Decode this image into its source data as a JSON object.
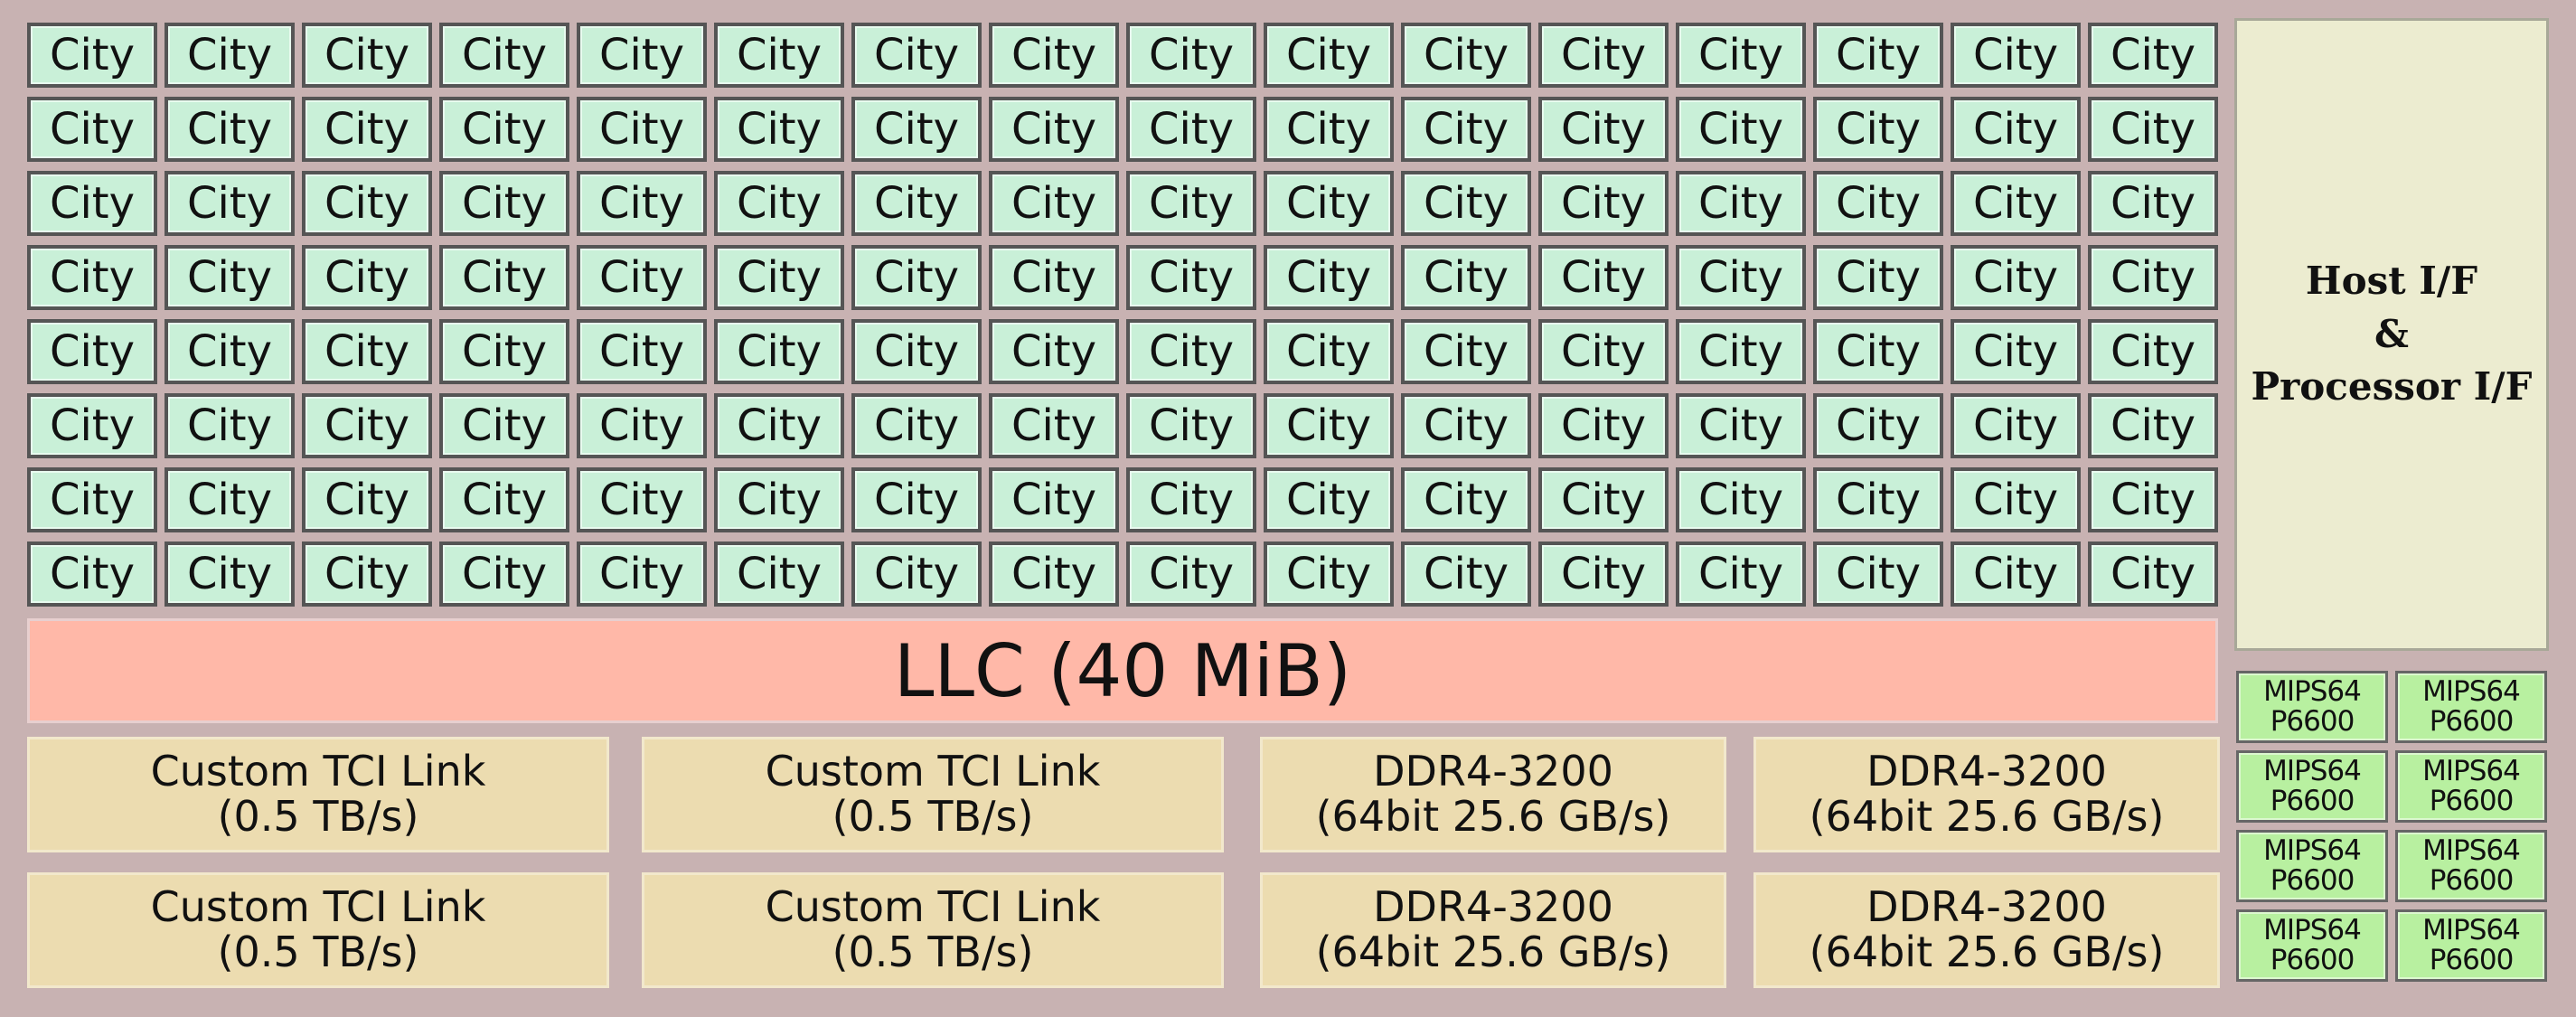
{
  "diagram": {
    "city_label": "City",
    "city_grid": {
      "rows": 8,
      "cols": 16
    },
    "llc_label": "LLC (40 MiB)",
    "host": {
      "line1": "Host I/F",
      "line2": "&",
      "line3": "Processor I/F"
    },
    "links": [
      {
        "line1": "Custom TCI Link",
        "line2": "(0.5 TB/s)"
      },
      {
        "line1": "Custom TCI Link",
        "line2": "(0.5 TB/s)"
      },
      {
        "line1": "DDR4-3200",
        "line2": "(64bit 25.6 GB/s)"
      },
      {
        "line1": "DDR4-3200",
        "line2": "(64bit 25.6 GB/s)"
      },
      {
        "line1": "Custom TCI Link",
        "line2": "(0.5 TB/s)"
      },
      {
        "line1": "Custom TCI Link",
        "line2": "(0.5 TB/s)"
      },
      {
        "line1": "DDR4-3200",
        "line2": "(64bit 25.6 GB/s)"
      },
      {
        "line1": "DDR4-3200",
        "line2": "(64bit 25.6 GB/s)"
      }
    ],
    "mips_cores": [
      {
        "line1": "MIPS64",
        "line2": "P6600"
      },
      {
        "line1": "MIPS64",
        "line2": "P6600"
      },
      {
        "line1": "MIPS64",
        "line2": "P6600"
      },
      {
        "line1": "MIPS64",
        "line2": "P6600"
      },
      {
        "line1": "MIPS64",
        "line2": "P6600"
      },
      {
        "line1": "MIPS64",
        "line2": "P6600"
      },
      {
        "line1": "MIPS64",
        "line2": "P6600"
      },
      {
        "line1": "MIPS64",
        "line2": "P6600"
      }
    ],
    "colors": {
      "background": "#c8b2b2",
      "city": "#c9f0d8",
      "llc": "#ffb8a8",
      "link": "#ecdcb0",
      "host": "#ececd0",
      "mips": "#b8f0a0"
    }
  }
}
